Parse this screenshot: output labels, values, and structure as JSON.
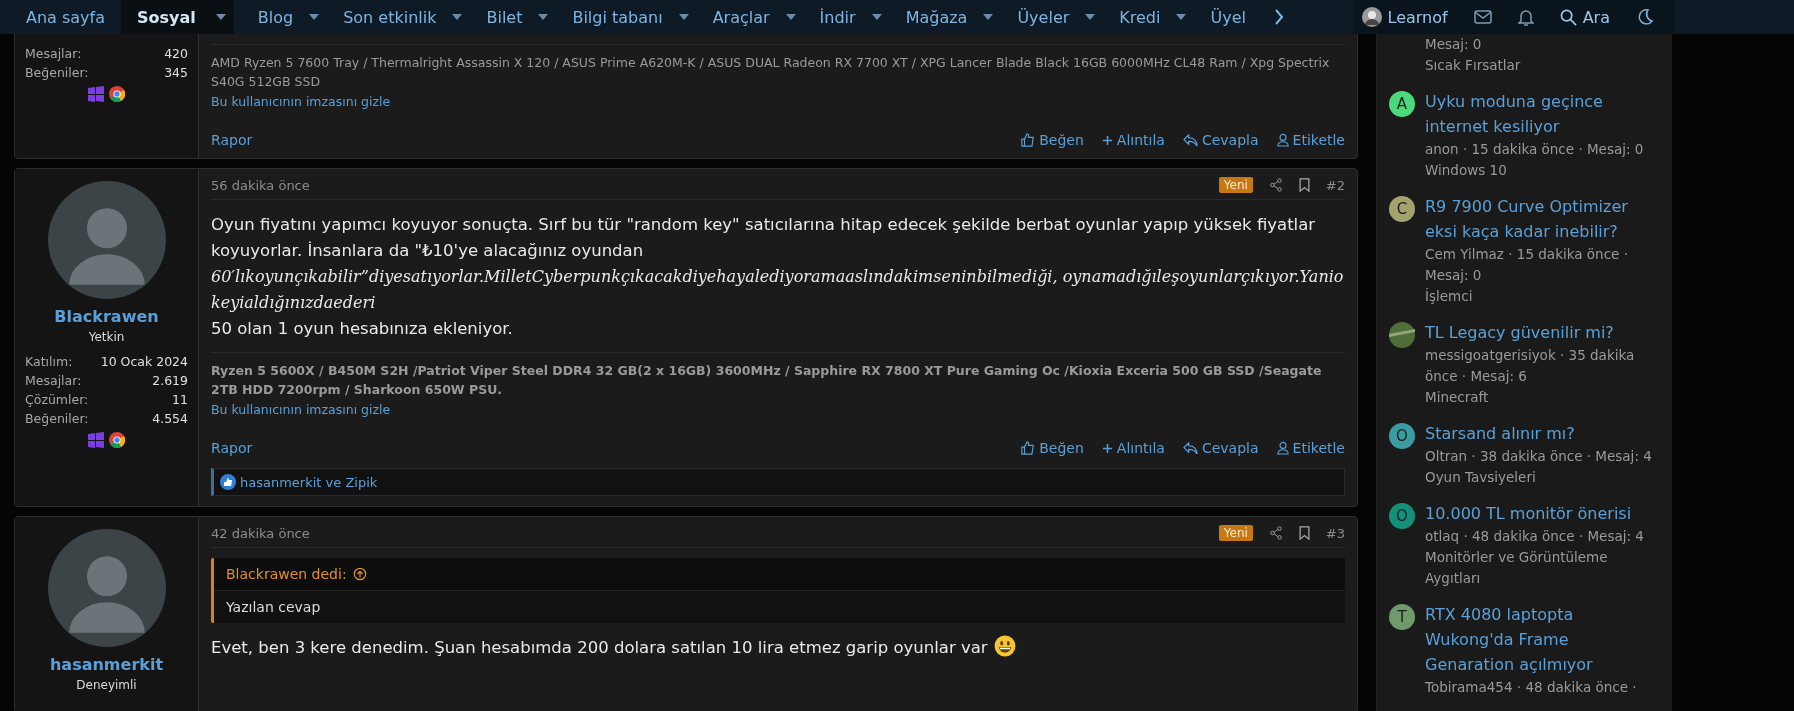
{
  "nav": {
    "items": [
      {
        "label": "Ana sayfa",
        "selected": false,
        "dropdown": false
      },
      {
        "label": "Sosyal",
        "selected": true,
        "dropdown": true
      },
      {
        "label": "Blog",
        "selected": false,
        "dropdown": true
      },
      {
        "label": "Son etkinlik",
        "selected": false,
        "dropdown": true
      },
      {
        "label": "Bilet",
        "selected": false,
        "dropdown": true
      },
      {
        "label": "Bilgi tabanı",
        "selected": false,
        "dropdown": true
      },
      {
        "label": "Araçlar",
        "selected": false,
        "dropdown": true
      },
      {
        "label": "İndir",
        "selected": false,
        "dropdown": true
      },
      {
        "label": "Mağaza",
        "selected": false,
        "dropdown": true
      },
      {
        "label": "Üyeler",
        "selected": false,
        "dropdown": true
      },
      {
        "label": "Kredi",
        "selected": false,
        "dropdown": true
      },
      {
        "label": "Üyel",
        "selected": false,
        "dropdown": false
      }
    ],
    "user": "Learnof",
    "search": "Ara"
  },
  "posts": [
    {
      "cut_top": true,
      "stats": [
        {
          "label": "Mesajlar:",
          "value": "420"
        },
        {
          "label": "Beğeniler:",
          "value": "345"
        }
      ],
      "signature": "AMD Ryzen 5 7600 Tray / Thermalright Assassin X 120 / ASUS Prime A620M-K / ASUS DUAL Radeon RX 7700 XT / XPG Lancer Blade Black 16GB 6000MHz CL48 Ram / Xpg Spectrix S40G 512GB SSD",
      "signature_bold": false,
      "hide_link": "Bu kullanıcının imzasını gizle",
      "report": "Rapor",
      "actions": [
        {
          "kind": "like",
          "label": "Beğen"
        },
        {
          "kind": "quote",
          "label": "Alıntıla"
        },
        {
          "kind": "reply",
          "label": "Cevapla"
        },
        {
          "kind": "mention",
          "label": "Etiketle"
        }
      ]
    },
    {
      "cut_top": false,
      "time": "56 dakika önce",
      "badge": "Yeni",
      "number": "#2",
      "avatar": true,
      "username": "Blackrawen",
      "role": "Yetkin",
      "stats": [
        {
          "label": "Katılım:",
          "value": "10 Ocak 2024"
        },
        {
          "label": "Mesajlar:",
          "value": "2.619"
        },
        {
          "label": "Çözümler:",
          "value": "11"
        },
        {
          "label": "Beğeniler:",
          "value": "4.554"
        }
      ],
      "body": [
        {
          "kind": "text",
          "text": "Oyun fiyatını yapımcı koyuyor sonuçta. Sırf bu tür \"random key\" satıcılarına hitap edecek şekilde berbat oyunlar yapıp yüksek fiyatlar koyuyorlar. İnsanlara da \"₺10'ye alacağınız oyundan"
        },
        {
          "kind": "math",
          "text": "60′lıkoyunçıkabilir”diyesatıyorlar.MilletCyberpunkçıkacakdiyehayalediyoramaaslındakimseninbilmediği, oynamadığıleşoyunlarçıkıyor.Yaniokeyialdığınızdaederi"
        },
        {
          "kind": "text",
          "text": "50 olan 1 oyun hesabınıza ekleniyor."
        }
      ],
      "signature": "Ryzen 5 5600X / B450M S2H /Patriot Viper Steel DDR4 32 GB(2 x 16GB) 3600MHz / Sapphire RX 7800 XT Pure Gaming Oc /Kioxia Exceria 500 GB SSD /Seagate 2TB HDD 7200rpm / Sharkoon 650W PSU.",
      "signature_bold": true,
      "hide_link": "Bu kullanıcının imzasını gizle",
      "report": "Rapor",
      "actions": [
        {
          "kind": "like",
          "label": "Beğen"
        },
        {
          "kind": "quote",
          "label": "Alıntıla"
        },
        {
          "kind": "reply",
          "label": "Cevapla"
        },
        {
          "kind": "mention",
          "label": "Etiketle"
        }
      ],
      "reactions": "hasanmerkit ve Zipik"
    },
    {
      "cut_top": false,
      "time": "42 dakika önce",
      "badge": "Yeni",
      "number": "#3",
      "avatar": true,
      "username": "hasanmerkit",
      "role": "Deneyimli",
      "quote": {
        "author": "Blackrawen dedi:",
        "text": "Yazılan cevap"
      },
      "body": [
        {
          "kind": "text",
          "text": "Evet, ben 3 kere denedim. Şuan hesabımda 200 dolara satılan 10 lira etmez garip oyunlar var"
        },
        {
          "kind": "emoji"
        }
      ]
    }
  ],
  "sidebar": {
    "items": [
      {
        "meta": "Mesaj: 0",
        "forum": "Sıcak Fırsatlar"
      },
      {
        "letter": "A",
        "color": "#4cd97b",
        "title": "Uyku moduna geçince internet kesiliyor",
        "meta": "anon · 15 dakika önce · Mesaj: 0",
        "forum": "Windows 10"
      },
      {
        "letter": "C",
        "color": "#a3a36e",
        "title": "R9 7900 Curve Optimizer eksi kaça kadar inebilir?",
        "meta": "Cem Yilmaz · 15 dakika önce · Mesaj: 0",
        "forum": "İşlemci"
      },
      {
        "photo": true,
        "title": "TL Legacy güvenilir mi?",
        "meta": "messigoatgerisiyok · 35 dakika önce · Mesaj: 6",
        "forum": "Minecraft"
      },
      {
        "letter": "O",
        "color": "#3a9ca0",
        "title": "Starsand alınır mı?",
        "meta": "Oltran · 38 dakika önce · Mesaj: 4",
        "forum": "Oyun Tavsiyeleri"
      },
      {
        "letter": "O",
        "color": "#12907a",
        "title": "10.000 TL monitör önerisi",
        "meta": "otlaq · 48 dakika önce · Mesaj: 4",
        "forum": "Monitörler ve Görüntüleme Aygıtları"
      },
      {
        "letter": "T",
        "color": "#6f9a6a",
        "title": "RTX 4080 laptopta Wukong'da Frame Genaration açılmıyor",
        "meta": "Tobirama454 · 48 dakika önce ·"
      }
    ]
  }
}
